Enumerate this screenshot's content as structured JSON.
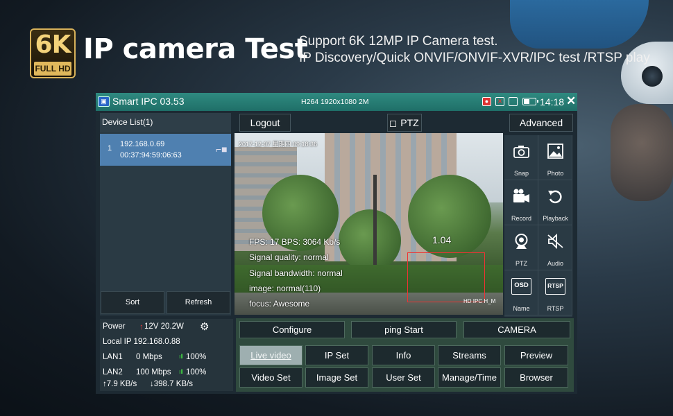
{
  "banner": {
    "badge_big": "6K",
    "badge_small": "FULL HD",
    "headline": "IP camera Test",
    "subline_1": "Support 6K 12MP IP Camera test.",
    "subline_2": "IP Discovery/Quick ONVIF/ONVIF-XVR/IPC test /RTSP play"
  },
  "statusbar": {
    "app_title": "Smart IPC 03.53",
    "stream_info": "H264 1920x1080 2M",
    "time": "14:18",
    "close": "✕"
  },
  "device_list": {
    "header": "Device List(1)",
    "devices": [
      {
        "index": "1",
        "ip": "192.168.0.69",
        "mac": "00:37:94:59:06:63"
      }
    ],
    "sort_label": "Sort",
    "refresh_label": "Refresh"
  },
  "power_panel": {
    "power_label": "Power",
    "power_value": "12V 20.2W",
    "local_ip": "Local IP 192.168.0.88",
    "lan1_label": "LAN1",
    "lan1_speed": "0 Mbps",
    "lan1_signal": "100%",
    "lan2_label": "LAN2",
    "lan2_speed": "100 Mbps",
    "lan2_signal": "100%",
    "upload": "↑7.9 KB/s",
    "download": "↓398.7 KB/s"
  },
  "toolbar": {
    "logout": "Logout",
    "ptz": "PTZ",
    "advanced": "Advanced"
  },
  "video": {
    "timestamp": "2017-12-07 星期四 09:18:36",
    "fps": "FPS: 17  BPS: 3064 Kb/s",
    "signal_quality": "Signal quality: normal",
    "signal_bandwidth": "Signal bandwidth: normal",
    "image": "image: normal(110)",
    "focus": "focus: Awesome",
    "zoom": "1.04",
    "watermark": "HD IPC H_M"
  },
  "side_tools": [
    {
      "label": "Snap",
      "icon": "camera-icon"
    },
    {
      "label": "Photo",
      "icon": "photo-icon"
    },
    {
      "label": "Record",
      "icon": "video-camera-icon"
    },
    {
      "label": "Playback",
      "icon": "playback-icon"
    },
    {
      "label": "PTZ",
      "icon": "ptz-icon"
    },
    {
      "label": "Audio",
      "icon": "speaker-mute-icon"
    },
    {
      "label": "Name",
      "icon": "osd-icon",
      "badge": "OSD"
    },
    {
      "label": "RTSP",
      "icon": "rtsp-icon",
      "badge": "RTSP"
    }
  ],
  "controls": {
    "row1": [
      "Configure",
      "ping  Start",
      "CAMERA"
    ],
    "row2": [
      "Live video",
      "IP Set",
      "Info",
      "Streams",
      "Preview"
    ],
    "row3": [
      "Video Set",
      "Image Set",
      "User Set",
      "Manage/Time",
      "Browser"
    ]
  },
  "colors": {
    "statusbar": "#1f6f68",
    "selected_device": "#4f80b0",
    "active_tab": "#9eafb0",
    "zoom_rect": "#ee3333",
    "power_arrow": "#e33b3b",
    "signal_green": "#44dd44"
  }
}
